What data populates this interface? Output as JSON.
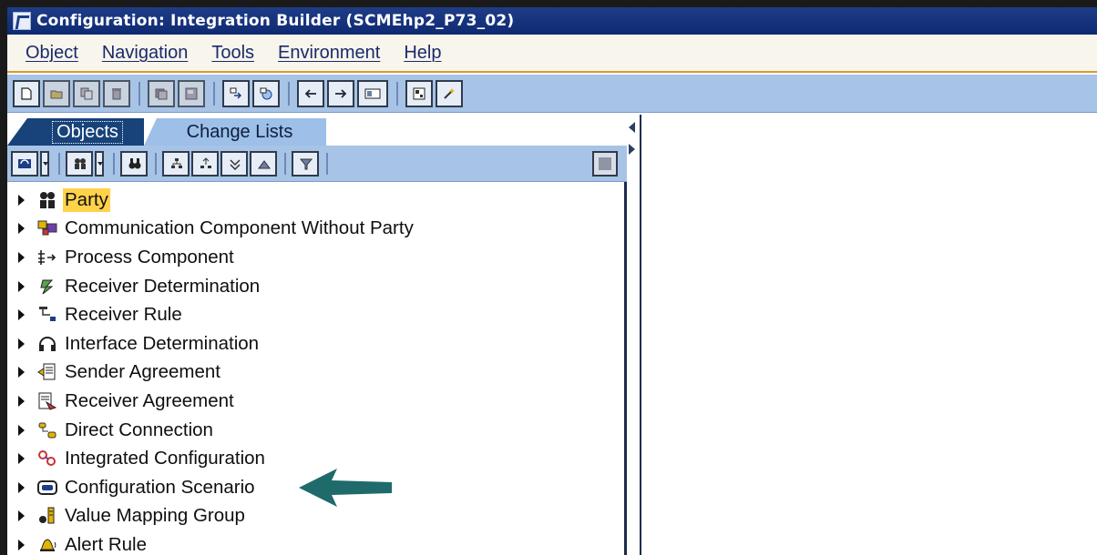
{
  "window": {
    "title": "Configuration: Integration Builder (SCMEhp2_P73_02)"
  },
  "menu": {
    "items": [
      "Object",
      "Navigation",
      "Tools",
      "Environment",
      "Help"
    ]
  },
  "toolbar": {
    "buttons": [
      "new-icon",
      "open-icon",
      "copy-icon",
      "delete-icon",
      "save-icon",
      "save-all-icon",
      "transfer-icon",
      "activate-icon",
      "back-icon",
      "forward-icon",
      "display-icon",
      "assistant-icon",
      "wizard-icon"
    ]
  },
  "tabs": {
    "objects": "Objects",
    "change_lists": "Change Lists"
  },
  "tree": {
    "items": [
      {
        "label": "Party",
        "icon": "party-icon",
        "selected": true
      },
      {
        "label": "Communication Component Without Party",
        "icon": "communication-component-icon"
      },
      {
        "label": "Process Component",
        "icon": "process-component-icon"
      },
      {
        "label": "Receiver Determination",
        "icon": "receiver-determination-icon"
      },
      {
        "label": "Receiver Rule",
        "icon": "receiver-rule-icon"
      },
      {
        "label": "Interface Determination",
        "icon": "interface-determination-icon"
      },
      {
        "label": "Sender Agreement",
        "icon": "sender-agreement-icon"
      },
      {
        "label": "Receiver Agreement",
        "icon": "receiver-agreement-icon"
      },
      {
        "label": "Direct Connection",
        "icon": "direct-connection-icon"
      },
      {
        "label": "Integrated Configuration",
        "icon": "integrated-configuration-icon"
      },
      {
        "label": "Configuration Scenario",
        "icon": "configuration-scenario-icon"
      },
      {
        "label": "Value Mapping Group",
        "icon": "value-mapping-group-icon"
      },
      {
        "label": "Alert Rule",
        "icon": "alert-rule-icon"
      }
    ]
  },
  "colors": {
    "titlebar": "#0e2a72",
    "toolbar": "#a7c3e6",
    "selection": "#ffd24a",
    "callout_arrow": "#1f6a6a"
  }
}
